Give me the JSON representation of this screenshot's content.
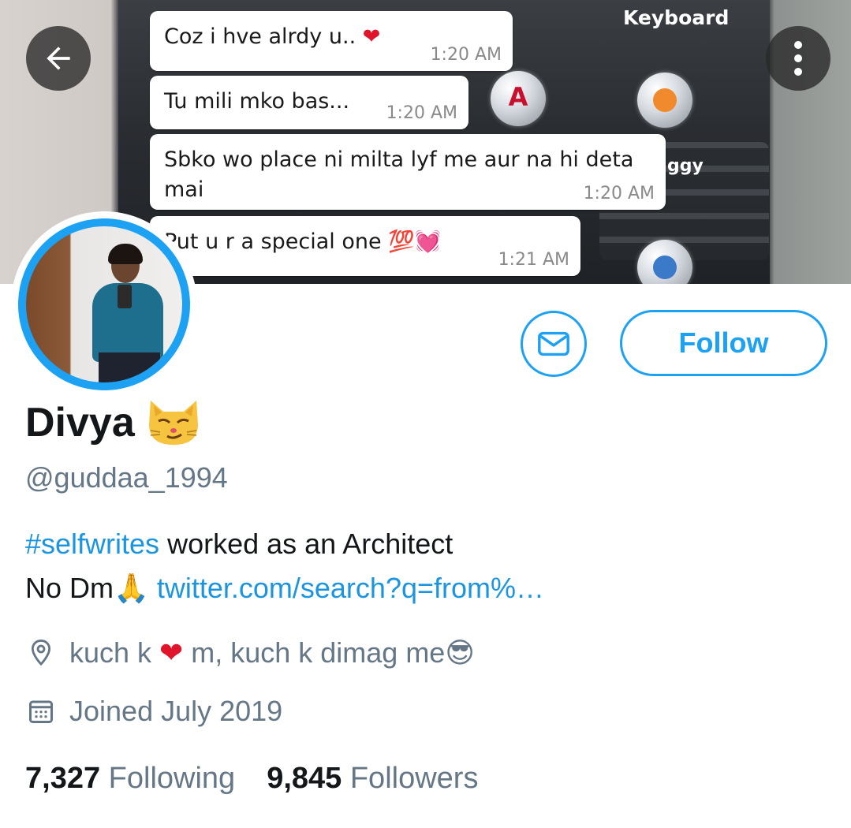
{
  "banner": {
    "chat": [
      {
        "text": "Coz i hve alrdy u.. ",
        "emoji": "❤",
        "time": "1:20 AM"
      },
      {
        "text": "Tu mili mko bas...",
        "emoji": "",
        "time": "1:20 AM"
      },
      {
        "text": "Sbko wo place ni milta lyf me aur na hi deta mai",
        "emoji": "",
        "time": "1:20 AM"
      },
      {
        "text": "Put u r a special one ",
        "emoji": "💯💓",
        "time": "1:21 AM"
      }
    ],
    "keyboard_label": "Keyboard",
    "partial_label": "ggy",
    "app_letter": "A"
  },
  "profile": {
    "name": "Divya",
    "handle": "@guddaa_1994",
    "bio_hashtag": "#selfwrites",
    "bio_line1_rest": " worked as an Architect",
    "bio_line2_text": "No Dm",
    "bio_line2_emoji": "🙏",
    "bio_link": " twitter.com/search?q=from%…",
    "location_part1": "kuch k ",
    "location_heart": "❤",
    "location_part2": " m, kuch k dimag me",
    "location_emoji": "😎",
    "joined": "Joined July 2019",
    "following_count": "7,327",
    "following_label": "Following",
    "followers_count": "9,845",
    "followers_label": "Followers"
  },
  "actions": {
    "follow_label": "Follow"
  },
  "icons": {
    "back": "arrow-left-icon",
    "more": "more-vertical-icon",
    "message": "envelope-icon",
    "location": "location-pin-icon",
    "calendar": "calendar-icon"
  },
  "colors": {
    "accent": "#1da1f2",
    "link": "#1b95e0",
    "text": "#14171a",
    "secondary": "#657786"
  }
}
